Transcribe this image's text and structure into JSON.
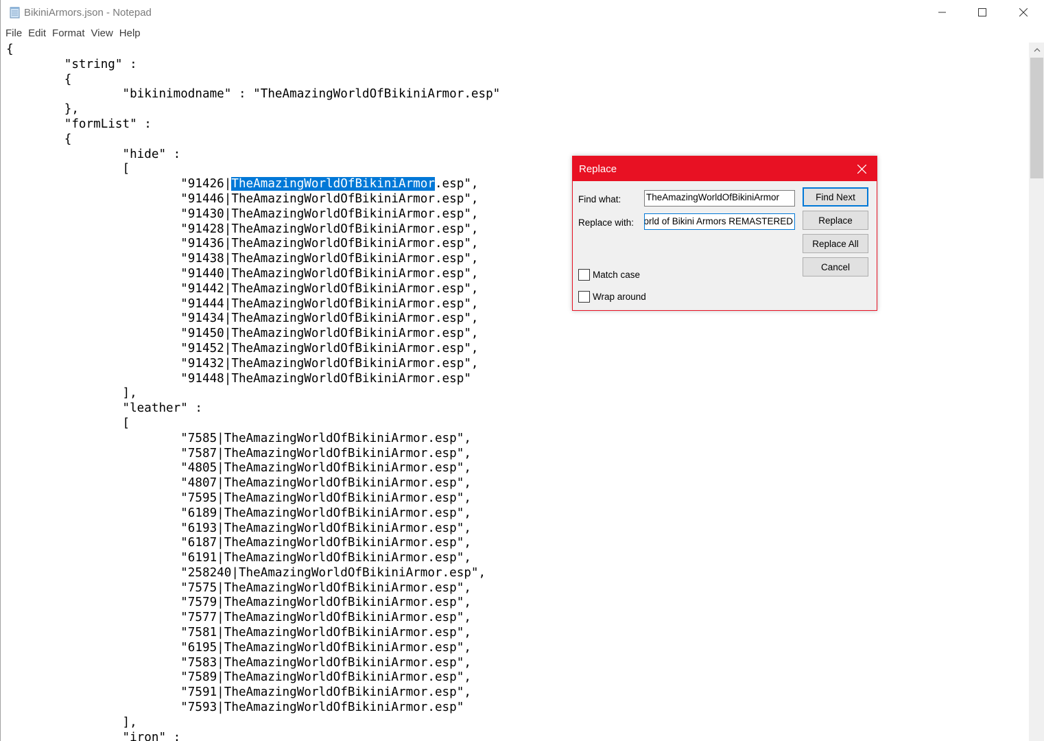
{
  "window": {
    "title": "BikiniArmors.json - Notepad"
  },
  "menu": [
    "File",
    "Edit",
    "Format",
    "View",
    "Help"
  ],
  "editor": {
    "lines": [
      "{",
      "        \"string\" :",
      "        {",
      "                \"bikinimodname\" : \"TheAmazingWorldOfBikiniArmor.esp\"",
      "        },",
      "        \"formList\" :",
      "        {",
      "                \"hide\" :",
      "                [",
      "                        \"91426|TheAmazingWorldOfBikiniArmor.esp\",",
      "                        \"91446|TheAmazingWorldOfBikiniArmor.esp\",",
      "                        \"91430|TheAmazingWorldOfBikiniArmor.esp\",",
      "                        \"91428|TheAmazingWorldOfBikiniArmor.esp\",",
      "                        \"91436|TheAmazingWorldOfBikiniArmor.esp\",",
      "                        \"91438|TheAmazingWorldOfBikiniArmor.esp\",",
      "                        \"91440|TheAmazingWorldOfBikiniArmor.esp\",",
      "                        \"91442|TheAmazingWorldOfBikiniArmor.esp\",",
      "                        \"91444|TheAmazingWorldOfBikiniArmor.esp\",",
      "                        \"91434|TheAmazingWorldOfBikiniArmor.esp\",",
      "                        \"91450|TheAmazingWorldOfBikiniArmor.esp\",",
      "                        \"91452|TheAmazingWorldOfBikiniArmor.esp\",",
      "                        \"91432|TheAmazingWorldOfBikiniArmor.esp\",",
      "                        \"91448|TheAmazingWorldOfBikiniArmor.esp\"",
      "                ],",
      "                \"leather\" :",
      "                [",
      "                        \"7585|TheAmazingWorldOfBikiniArmor.esp\",",
      "                        \"7587|TheAmazingWorldOfBikiniArmor.esp\",",
      "                        \"4805|TheAmazingWorldOfBikiniArmor.esp\",",
      "                        \"4807|TheAmazingWorldOfBikiniArmor.esp\",",
      "                        \"7595|TheAmazingWorldOfBikiniArmor.esp\",",
      "                        \"6189|TheAmazingWorldOfBikiniArmor.esp\",",
      "                        \"6193|TheAmazingWorldOfBikiniArmor.esp\",",
      "                        \"6187|TheAmazingWorldOfBikiniArmor.esp\",",
      "                        \"6191|TheAmazingWorldOfBikiniArmor.esp\",",
      "                        \"258240|TheAmazingWorldOfBikiniArmor.esp\",",
      "                        \"7575|TheAmazingWorldOfBikiniArmor.esp\",",
      "                        \"7579|TheAmazingWorldOfBikiniArmor.esp\",",
      "                        \"7577|TheAmazingWorldOfBikiniArmor.esp\",",
      "                        \"7581|TheAmazingWorldOfBikiniArmor.esp\",",
      "                        \"6195|TheAmazingWorldOfBikiniArmor.esp\",",
      "                        \"7583|TheAmazingWorldOfBikiniArmor.esp\",",
      "                        \"7589|TheAmazingWorldOfBikiniArmor.esp\",",
      "                        \"7591|TheAmazingWorldOfBikiniArmor.esp\",",
      "                        \"7593|TheAmazingWorldOfBikiniArmor.esp\"",
      "                ],",
      "                \"iron\" :"
    ],
    "selected_text": "TheAmazingWorldOfBikiniArmor",
    "selected_line": 9
  },
  "replace_dialog": {
    "title": "Replace",
    "find_label": "Find what:",
    "find_value": "TheAmazingWorldOfBikiniArmor",
    "replace_label": "Replace with:",
    "replace_value": "The Amazing World of Bikini Armors REMASTERED",
    "buttons": {
      "find_next": "Find Next",
      "replace": "Replace",
      "replace_all": "Replace All",
      "cancel": "Cancel"
    },
    "match_case_label": "Match case",
    "match_case_checked": false,
    "wrap_around_label": "Wrap around",
    "wrap_around_checked": false
  },
  "colors": {
    "dialog_accent": "#e81123",
    "selection": "#0078d7"
  }
}
